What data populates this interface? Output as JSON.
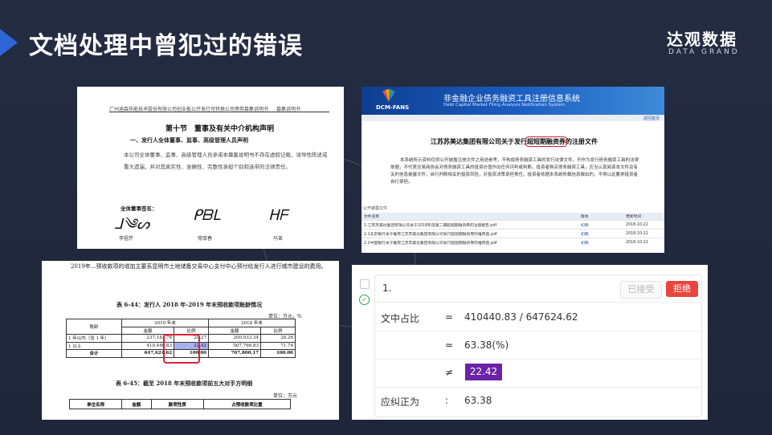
{
  "slide": {
    "title": "文档处理中曾犯过的错误",
    "logo_cn": "达观数据",
    "logo_en": "DATA GRAND",
    "accent": "#2f66d6"
  },
  "p1": {
    "header_left": "广州迪森热能技术股份有限公司创业板公开发行可转换公司债券募集说明书",
    "header_right": "募集说明书",
    "section": "第十节　董事及有关中介机构声明",
    "sub": "一、发行人全体董事、监事、高级管理人员声明",
    "body": "本公司全体董事、监事、高级管理人员承诺本募集说明书不存在虚假记载、误导性陈述或重大遗漏，并对其真实性、准确性、完整性承担个别和连带的法律责任。",
    "sig_title": "全体董事签名：",
    "signatures": [
      {
        "name": "李祖芹"
      },
      {
        "name": "常厚春"
      },
      {
        "name": "马革"
      }
    ]
  },
  "p2": {
    "brand": "DCM-FANS",
    "banner_title": "非金融企业债务融资工具注册信息系统",
    "banner_sub": "Debt Capital Market Filing Analysis Notification System",
    "top_link": "返回首页",
    "doc_title_pre": "江苏苏美达集团有限公司关于发行",
    "doc_title_hl": "超短期融资券",
    "doc_title_post": "的注册文件",
    "text": "本系统所示资料仅供公开披露注册文件之用途参考，不构成债务融资工具的发行法律文件，不作为发行债务融资工具的法律依据，不代表交易商协会对债务融资工具的投资价值作出任何评判或判断。投资者购买债务融资工具，应当认真阅读本文件及有关的信息披露文件，自行判断相关的投资风险，对投资决策承担责任。投资者依据本系统所载信息做出的，不得以此要求投资者自行承担。",
    "list_title": "公开披露文件",
    "columns": [
      "文件名称",
      "版本",
      "更新时间"
    ],
    "rows": [
      {
        "name": "1.江苏苏美达集团有限公司关于2018年度第二期超短期融资券的注册报告.pdf",
        "ver": "初稿",
        "date": "2018-10-22"
      },
      {
        "name": "2.1北京银行关于推荐江苏苏美达集团有限公司发行超短期融资券的推荐函.pdf",
        "ver": "初稿",
        "date": "2018-10-22"
      },
      {
        "name": "2.2中国银行关于推荐江苏苏美达集团有限公司发行超短期融资券的推荐函.pdf",
        "ver": "初稿",
        "date": "2018-10-22"
      }
    ]
  },
  "p3": {
    "text": "2019年...预收款项的增加主要系昆明市土地储备交易中心支付中心预付给发行人进行城市建设的费用。",
    "caption": "表 6-44：发行人 2018 年-2019 年末预收款项账龄情况",
    "unit": "单位：万元，%",
    "h_group": "账龄",
    "h_2019": "2019 年末",
    "h_2018": "2018 年末",
    "h_amt": "金额",
    "h_ratio": "比例",
    "rows": [
      {
        "label": "1 年以内（含 1 年）",
        "a19": "237,183.78",
        "r19": "29.27",
        "a18": "200,033.34",
        "r18": "28.26"
      },
      {
        "label": "1 以上",
        "a19": "410,440.83",
        "r19": "22.42",
        "a18": "507,766.83",
        "r18": "71.74"
      },
      {
        "label": "合计",
        "a19": "647,624.62",
        "r19": "100.00",
        "a18": "707,800.17",
        "r18": "100.00"
      }
    ],
    "caption2": "表 6-45：截至 2018 年末预收款项前五大对手方明细",
    "unit2": "单位：万元",
    "t2_cols": [
      "单位名称",
      "金额",
      "款项性质",
      "占预收款项比重"
    ]
  },
  "p4": {
    "index": "1.",
    "accept": "已接受",
    "reject": "拒绝",
    "label1": "文中占比",
    "op1": "=",
    "val1": "410440.83 / 647624.62",
    "op2": "≈",
    "val2": "63.38(%)",
    "op3": "≠",
    "val3": "22.42",
    "label4": "应纠正为",
    "op4": ":",
    "val4": "63.38",
    "check_icon": "check-circle-icon"
  }
}
